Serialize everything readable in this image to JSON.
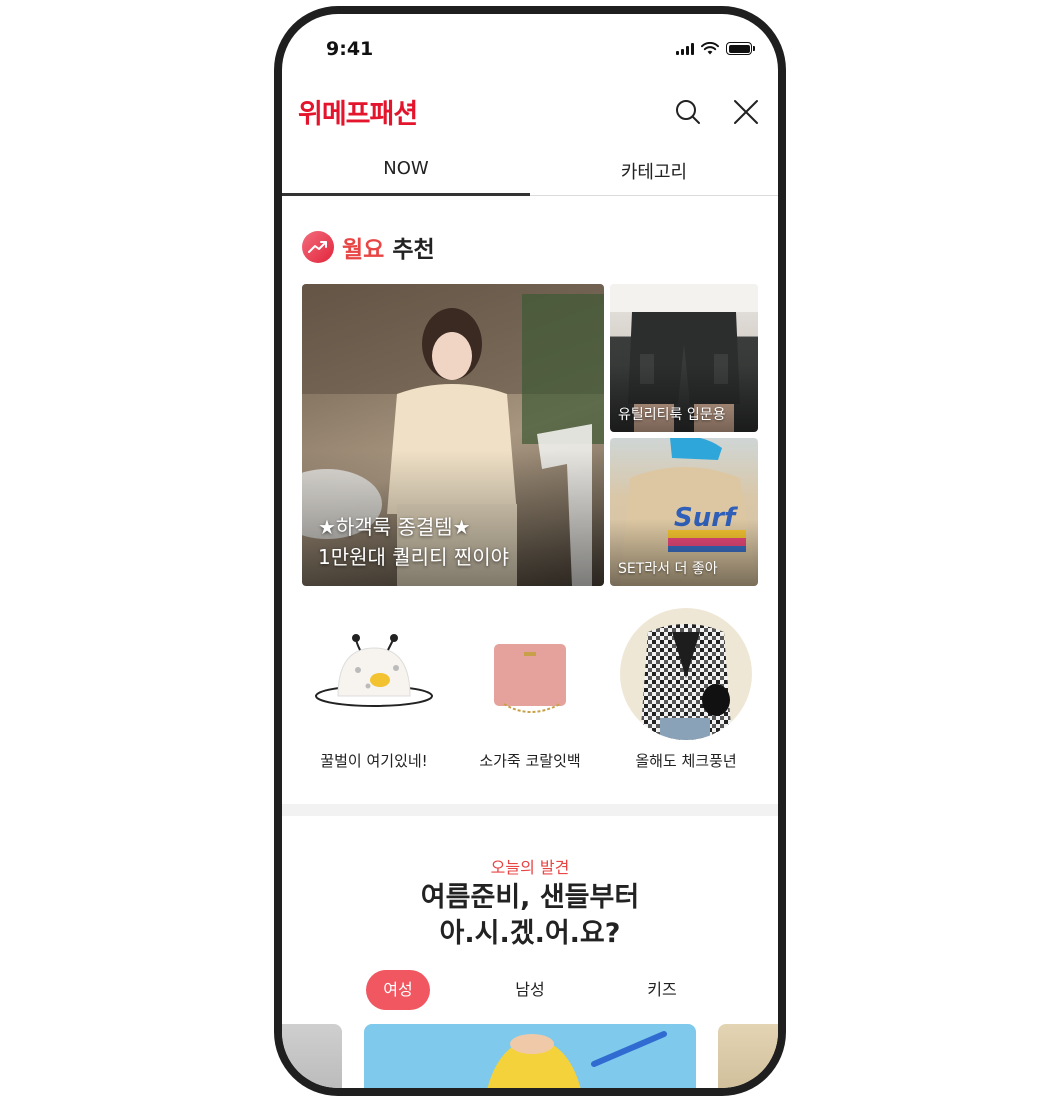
{
  "status": {
    "time": "9:41"
  },
  "header": {
    "brand": "위메프패션"
  },
  "icons": {
    "search": "search-icon",
    "close": "close-icon",
    "trend": "trending-up-icon"
  },
  "tabs": [
    {
      "label": "NOW",
      "active": true
    },
    {
      "label": "카테고리",
      "active": false
    }
  ],
  "recommend": {
    "title_highlight": "월요",
    "title_rest": "추천",
    "main": {
      "line1": "★하객룩 종결템★",
      "line2": "1만원대 퀄리티 찐이야"
    },
    "side": [
      {
        "caption": "유틸리티룩 입문용"
      },
      {
        "caption": "SET라서 더 좋아"
      }
    ],
    "tile_text": "Surf"
  },
  "circles": [
    {
      "label": "꿀벌이 여기있네!"
    },
    {
      "label": "소가죽 코랄잇백"
    },
    {
      "label": "올해도 체크풍년"
    }
  ],
  "discovery": {
    "subtitle": "오늘의 발견",
    "title_line1": "여름준비, 샌들부터",
    "title_line2": "아.시.겠.어.요?",
    "chips": [
      {
        "label": "여성",
        "active": true
      },
      {
        "label": "남성",
        "active": false
      },
      {
        "label": "키즈",
        "active": false
      }
    ]
  },
  "colors": {
    "brand": "#e3142b",
    "accent": "#f05760",
    "highlight": "#e84545",
    "text": "#222222"
  }
}
